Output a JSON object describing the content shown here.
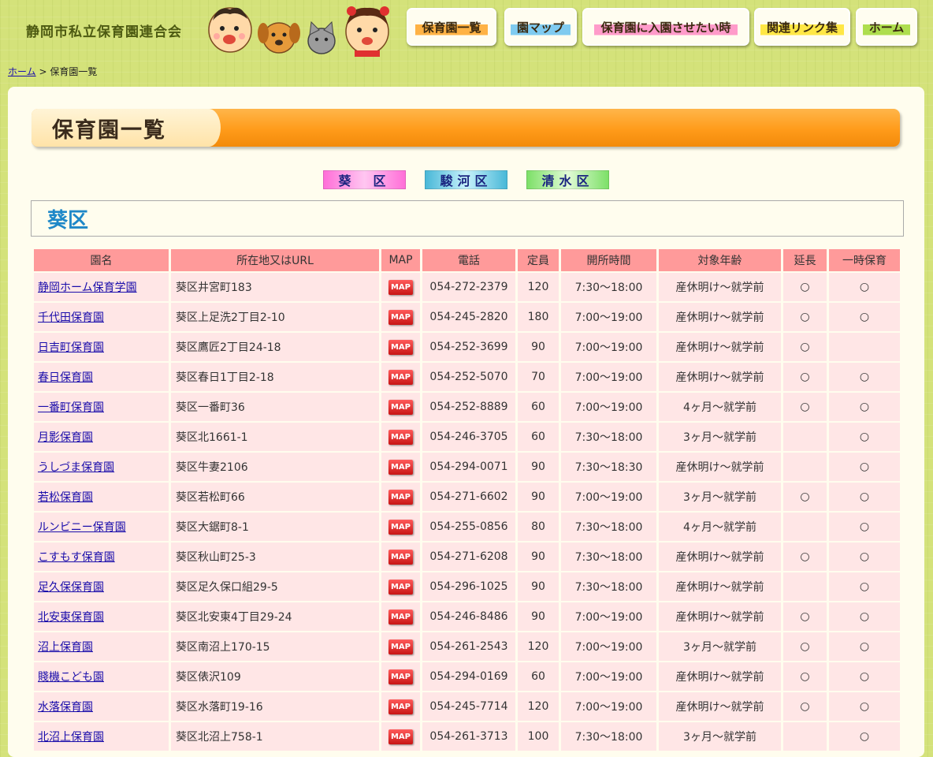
{
  "header": {
    "site_title": "静岡市私立保育園連合会",
    "nav": [
      {
        "label": "保育園一覧"
      },
      {
        "label": "園マップ"
      },
      {
        "label": "保育園に入園させたい時"
      },
      {
        "label": "関連リンク集"
      },
      {
        "label": "ホーム"
      }
    ]
  },
  "breadcrumb": {
    "home": "ホーム",
    "separator": " > ",
    "current": "保育園一覧"
  },
  "page_title": "保育園一覧",
  "wards": [
    "葵　区",
    "駿河区",
    "清水区"
  ],
  "section_title": "葵区",
  "table": {
    "headers": [
      "園名",
      "所在地又はURL",
      "MAP",
      "電話",
      "定員",
      "開所時間",
      "対象年齢",
      "延長",
      "一時保育"
    ],
    "map_label": "MAP",
    "rows": [
      {
        "name": "静岡ホーム保育学園",
        "address": "葵区井宮町183",
        "phone": "054-272-2379",
        "capacity": "120",
        "hours": "7:30〜18:00",
        "age": "産休明け〜就学前",
        "extended": "○",
        "temporary": "○"
      },
      {
        "name": "千代田保育園",
        "address": "葵区上足洗2丁目2-10",
        "phone": "054-245-2820",
        "capacity": "180",
        "hours": "7:00〜19:00",
        "age": "産休明け〜就学前",
        "extended": "○",
        "temporary": "○"
      },
      {
        "name": "日吉町保育園",
        "address": "葵区鷹匠2丁目24-18",
        "phone": "054-252-3699",
        "capacity": "90",
        "hours": "7:00〜19:00",
        "age": "産休明け〜就学前",
        "extended": "○",
        "temporary": ""
      },
      {
        "name": "春日保育園",
        "address": "葵区春日1丁目2-18",
        "phone": "054-252-5070",
        "capacity": "70",
        "hours": "7:00〜19:00",
        "age": "産休明け〜就学前",
        "extended": "○",
        "temporary": "○"
      },
      {
        "name": "一番町保育園",
        "address": "葵区一番町36",
        "phone": "054-252-8889",
        "capacity": "60",
        "hours": "7:00〜19:00",
        "age": "4ヶ月〜就学前",
        "extended": "○",
        "temporary": "○"
      },
      {
        "name": "月影保育園",
        "address": "葵区北1661-1",
        "phone": "054-246-3705",
        "capacity": "60",
        "hours": "7:30〜18:00",
        "age": "3ヶ月〜就学前",
        "extended": "",
        "temporary": "○"
      },
      {
        "name": "うしづま保育園",
        "address": "葵区牛妻2106",
        "phone": "054-294-0071",
        "capacity": "90",
        "hours": "7:30〜18:30",
        "age": "産休明け〜就学前",
        "extended": "",
        "temporary": "○"
      },
      {
        "name": "若松保育園",
        "address": "葵区若松町66",
        "phone": "054-271-6602",
        "capacity": "90",
        "hours": "7:00〜19:00",
        "age": "3ヶ月〜就学前",
        "extended": "○",
        "temporary": "○"
      },
      {
        "name": "ルンビニー保育園",
        "address": "葵区大鋸町8-1",
        "phone": "054-255-0856",
        "capacity": "80",
        "hours": "7:30〜18:00",
        "age": "4ヶ月〜就学前",
        "extended": "",
        "temporary": "○"
      },
      {
        "name": "こすもす保育園",
        "address": "葵区秋山町25-3",
        "phone": "054-271-6208",
        "capacity": "90",
        "hours": "7:30〜18:00",
        "age": "産休明け〜就学前",
        "extended": "○",
        "temporary": "○"
      },
      {
        "name": "足久保保育園",
        "address": "葵区足久保口組29-5",
        "phone": "054-296-1025",
        "capacity": "90",
        "hours": "7:30〜18:00",
        "age": "産休明け〜就学前",
        "extended": "",
        "temporary": "○"
      },
      {
        "name": "北安東保育園",
        "address": "葵区北安東4丁目29-24",
        "phone": "054-246-8486",
        "capacity": "90",
        "hours": "7:00〜19:00",
        "age": "産休明け〜就学前",
        "extended": "○",
        "temporary": "○"
      },
      {
        "name": "沼上保育園",
        "address": "葵区南沼上170-15",
        "phone": "054-261-2543",
        "capacity": "120",
        "hours": "7:00〜19:00",
        "age": "3ヶ月〜就学前",
        "extended": "○",
        "temporary": "○"
      },
      {
        "name": "賤機こども園",
        "address": "葵区俵沢109",
        "phone": "054-294-0169",
        "capacity": "60",
        "hours": "7:00〜19:00",
        "age": "産休明け〜就学前",
        "extended": "○",
        "temporary": "○"
      },
      {
        "name": "水落保育園",
        "address": "葵区水落町19-16",
        "phone": "054-245-7714",
        "capacity": "120",
        "hours": "7:00〜19:00",
        "age": "産休明け〜就学前",
        "extended": "○",
        "temporary": "○"
      },
      {
        "name": "北沼上保育園",
        "address": "葵区北沼上758-1",
        "phone": "054-261-3713",
        "capacity": "100",
        "hours": "7:30〜18:00",
        "age": "3ヶ月〜就学前",
        "extended": "",
        "temporary": "○"
      }
    ]
  }
}
